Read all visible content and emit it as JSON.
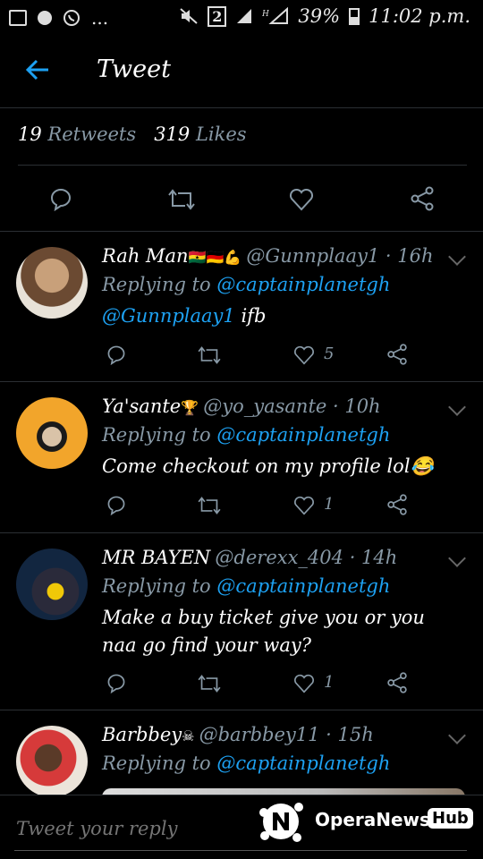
{
  "status": {
    "battery": "39%",
    "time": "11:02 p.m.",
    "sim": "2",
    "more": "..."
  },
  "header": {
    "title": "Tweet"
  },
  "stats": {
    "retweets_count": "19",
    "retweets_label": "Retweets",
    "likes_count": "319",
    "likes_label": "Likes"
  },
  "tweets": [
    {
      "name": "Rah Man",
      "emojis": "🇬🇭🇩🇪💪",
      "handle": "@Gunnplaay1 · 16h",
      "replying_prefix": "Replying to",
      "replying_to": "@captainplanetgh",
      "mention": "@Gunnplaay1",
      "text": "ifb",
      "likes": "5"
    },
    {
      "name": "Ya'sante",
      "emojis": "🏆",
      "handle": "@yo_yasante · 10h",
      "replying_prefix": "Replying to",
      "replying_to": "@captainplanetgh",
      "text": "Come checkout on my profile lol😂",
      "likes": "1"
    },
    {
      "name": "MR BAYEN",
      "emojis": "",
      "handle": "@derexx_404 · 14h",
      "replying_prefix": "Replying to",
      "replying_to": "@captainplanetgh",
      "text": "Make a buy ticket give you or you naa go find your way?",
      "likes": "1"
    },
    {
      "name": "Barbbey",
      "emojis": "☠",
      "handle": "@barbbey11 · 15h",
      "replying_prefix": "Replying to",
      "replying_to": "@captainplanetgh"
    }
  ],
  "reply": {
    "placeholder": "Tweet your reply"
  },
  "watermark": {
    "text": "OperaNews",
    "badge": "Hub"
  },
  "colors": {
    "accent": "#1da1f2",
    "muted": "#8899a6",
    "background": "#000000"
  }
}
